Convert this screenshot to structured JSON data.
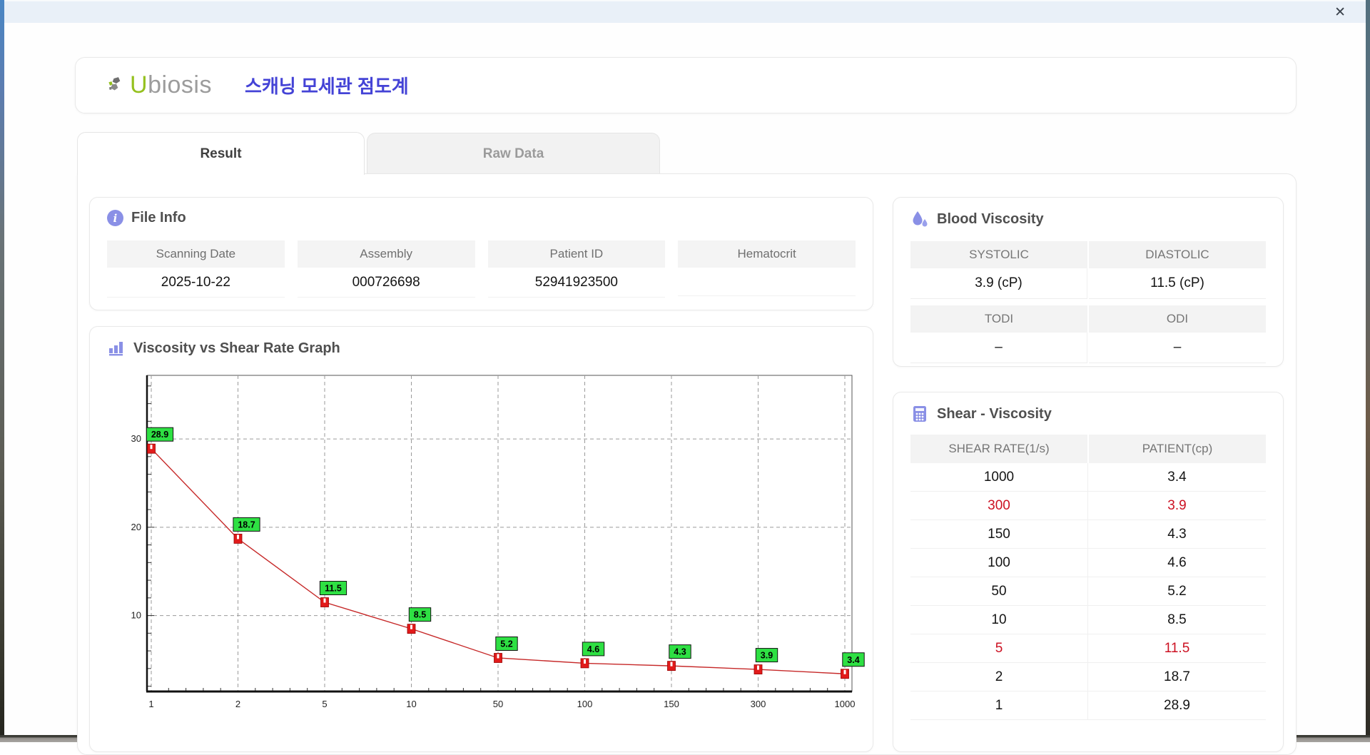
{
  "window": {
    "close_label": "✕"
  },
  "header": {
    "logo": {
      "u": "U",
      "rest": "biosis"
    },
    "app_title": "스캐닝 모세관 점도계"
  },
  "tabs": [
    {
      "label": "Result",
      "active": true
    },
    {
      "label": "Raw Data",
      "active": false
    }
  ],
  "file_info": {
    "title": "File Info",
    "fields": [
      {
        "label": "Scanning Date",
        "value": "2025-10-22"
      },
      {
        "label": "Assembly",
        "value": "000726698"
      },
      {
        "label": "Patient ID",
        "value": "52941923500"
      },
      {
        "label": "Hematocrit",
        "value": ""
      }
    ]
  },
  "blood_viscosity": {
    "title": "Blood Viscosity",
    "groups": [
      {
        "labels": [
          "SYSTOLIC",
          "DIASTOLIC"
        ],
        "values": [
          "3.9 (cP)",
          "11.5 (cP)"
        ]
      },
      {
        "labels": [
          "TODI",
          "ODI"
        ],
        "values": [
          "–",
          "–"
        ]
      }
    ]
  },
  "graph_section": {
    "title": "Viscosity vs Shear Rate Graph"
  },
  "chart_data": {
    "type": "line",
    "title": "Viscosity vs Shear Rate Graph",
    "x": [
      1,
      2,
      5,
      10,
      50,
      100,
      150,
      300,
      1000
    ],
    "x_spacing": "categorical-even",
    "series": [
      {
        "name": "PATIENT(cp)",
        "values": [
          28.9,
          18.7,
          11.5,
          8.5,
          5.2,
          4.6,
          4.3,
          3.9,
          3.4
        ]
      }
    ],
    "point_labels": [
      "28.9",
      "18.7",
      "11.5",
      "8.5",
      "5.2",
      "4.6",
      "4.3",
      "3.9",
      "3.4"
    ],
    "xlabel": "",
    "ylabel": "",
    "ylim": [
      1.4,
      37.2
    ],
    "yticks": [
      10,
      20,
      30
    ],
    "grid": true,
    "legend": "none",
    "line_color": "#c62828",
    "marker_color": "#e21b1b",
    "label_bg": "#2ee043",
    "label_text_color": "#000000",
    "grid_color": "#9a9a9a"
  },
  "shear_viscosity": {
    "title": "Shear - Viscosity",
    "columns": [
      "SHEAR RATE(1/s)",
      "PATIENT(cp)"
    ],
    "rows": [
      {
        "shear_rate": "1000",
        "patient": "3.4",
        "highlight": false
      },
      {
        "shear_rate": "300",
        "patient": "3.9",
        "highlight": true
      },
      {
        "shear_rate": "150",
        "patient": "4.3",
        "highlight": false
      },
      {
        "shear_rate": "100",
        "patient": "4.6",
        "highlight": false
      },
      {
        "shear_rate": "50",
        "patient": "5.2",
        "highlight": false
      },
      {
        "shear_rate": "10",
        "patient": "8.5",
        "highlight": false
      },
      {
        "shear_rate": "5",
        "patient": "11.5",
        "highlight": true
      },
      {
        "shear_rate": "2",
        "patient": "18.7",
        "highlight": false
      },
      {
        "shear_rate": "1",
        "patient": "28.9",
        "highlight": false
      }
    ]
  },
  "colors": {
    "accent_icon": "#8a90e6",
    "title_blue": "#4443d6",
    "logo_green": "#95c11f",
    "highlight_red": "#cc1122",
    "titlebar": "#e9f0f8"
  }
}
